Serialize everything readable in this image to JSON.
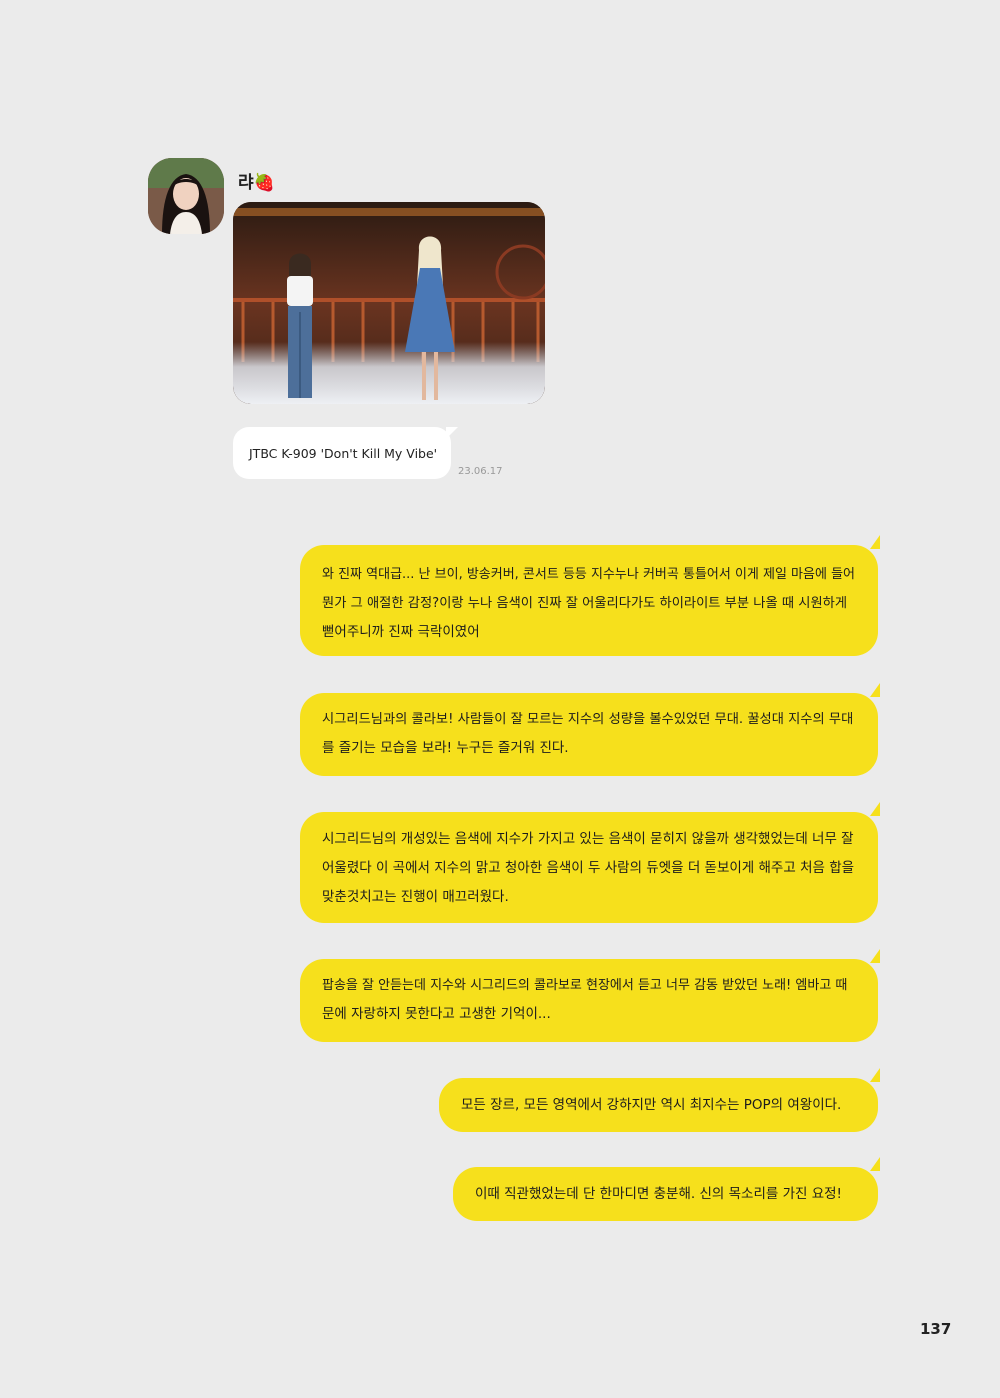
{
  "sender": {
    "name": "랴🍓",
    "avatar_icon": "profile-photo",
    "photo_icon": "stage-performance-photo",
    "caption": "JTBC K-909 'Don't Kill My Vibe'",
    "timestamp": "23.06.17"
  },
  "messages": [
    {
      "lines": [
        "와 진짜 역대급... 난 브이, 방송커버, 콘서트 등등 지수누나 커버곡 통틀어서 이게 제일 마음에 들어",
        "뭔가 그 애절한 감정?이랑 누나 음색이 진짜 잘 어울리다가도 하이라이트 부분 나올 때 시원하게",
        "뻗어주니까 진짜 극락이였어"
      ]
    },
    {
      "lines": [
        "시그리드님과의 콜라보! 사람들이 잘 모르는 지수의 성량을 볼수있었던 무대. 꿀성대 지수의 무대",
        "를 즐기는 모습을 보라! 누구든 즐거워 진다."
      ]
    },
    {
      "lines": [
        "시그리드님의 개성있는 음색에 지수가 가지고 있는 음색이 묻히지 않을까 생각했었는데 너무 잘",
        "어울렸다 이 곡에서 지수의 맑고 청아한 음색이 두 사람의 듀엣을 더 돋보이게 해주고 처음 합을",
        "맞춘것치고는 진행이 매끄러웠다."
      ]
    },
    {
      "lines": [
        "팝송을 잘 안듣는데 지수와 시그리드의 콜라보로 현장에서 듣고 너무 감동 받았던 노래! 엠바고 때",
        "문에 자랑하지 못한다고 고생한 기억이..."
      ]
    },
    {
      "lines": [
        "모든 장르, 모든 영역에서 강하지만 역시 최지수는 POP의 여왕이다."
      ]
    },
    {
      "lines": [
        "이때 직관했었는데 단 한마디면 충분해. 신의 목소리를 가진 요정!"
      ]
    }
  ],
  "page_number": "137",
  "colors": {
    "background": "#ebebeb",
    "bubble_yellow": "#f6e01c",
    "bubble_white": "#ffffff"
  }
}
